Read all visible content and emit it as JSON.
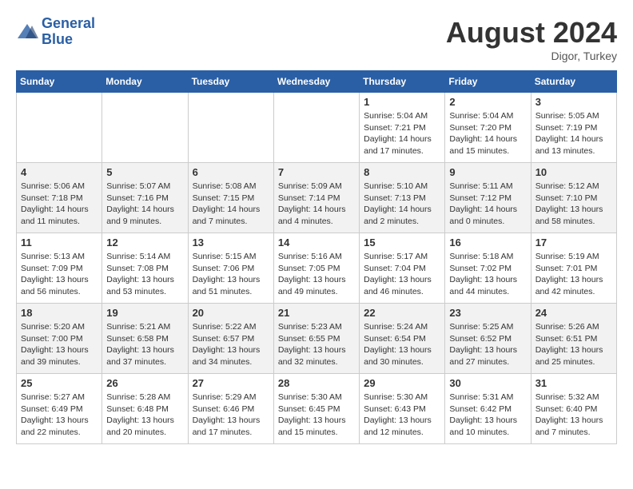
{
  "header": {
    "logo_line1": "General",
    "logo_line2": "Blue",
    "month_year": "August 2024",
    "location": "Digor, Turkey"
  },
  "days_of_week": [
    "Sunday",
    "Monday",
    "Tuesday",
    "Wednesday",
    "Thursday",
    "Friday",
    "Saturday"
  ],
  "weeks": [
    [
      {
        "day": "",
        "empty": true
      },
      {
        "day": "",
        "empty": true
      },
      {
        "day": "",
        "empty": true
      },
      {
        "day": "",
        "empty": true
      },
      {
        "day": "1",
        "sunrise": "5:04 AM",
        "sunset": "7:21 PM",
        "daylight": "14 hours and 17 minutes."
      },
      {
        "day": "2",
        "sunrise": "5:04 AM",
        "sunset": "7:20 PM",
        "daylight": "14 hours and 15 minutes."
      },
      {
        "day": "3",
        "sunrise": "5:05 AM",
        "sunset": "7:19 PM",
        "daylight": "14 hours and 13 minutes."
      }
    ],
    [
      {
        "day": "4",
        "sunrise": "5:06 AM",
        "sunset": "7:18 PM",
        "daylight": "14 hours and 11 minutes."
      },
      {
        "day": "5",
        "sunrise": "5:07 AM",
        "sunset": "7:16 PM",
        "daylight": "14 hours and 9 minutes."
      },
      {
        "day": "6",
        "sunrise": "5:08 AM",
        "sunset": "7:15 PM",
        "daylight": "14 hours and 7 minutes."
      },
      {
        "day": "7",
        "sunrise": "5:09 AM",
        "sunset": "7:14 PM",
        "daylight": "14 hours and 4 minutes."
      },
      {
        "day": "8",
        "sunrise": "5:10 AM",
        "sunset": "7:13 PM",
        "daylight": "14 hours and 2 minutes."
      },
      {
        "day": "9",
        "sunrise": "5:11 AM",
        "sunset": "7:12 PM",
        "daylight": "14 hours and 0 minutes."
      },
      {
        "day": "10",
        "sunrise": "5:12 AM",
        "sunset": "7:10 PM",
        "daylight": "13 hours and 58 minutes."
      }
    ],
    [
      {
        "day": "11",
        "sunrise": "5:13 AM",
        "sunset": "7:09 PM",
        "daylight": "13 hours and 56 minutes."
      },
      {
        "day": "12",
        "sunrise": "5:14 AM",
        "sunset": "7:08 PM",
        "daylight": "13 hours and 53 minutes."
      },
      {
        "day": "13",
        "sunrise": "5:15 AM",
        "sunset": "7:06 PM",
        "daylight": "13 hours and 51 minutes."
      },
      {
        "day": "14",
        "sunrise": "5:16 AM",
        "sunset": "7:05 PM",
        "daylight": "13 hours and 49 minutes."
      },
      {
        "day": "15",
        "sunrise": "5:17 AM",
        "sunset": "7:04 PM",
        "daylight": "13 hours and 46 minutes."
      },
      {
        "day": "16",
        "sunrise": "5:18 AM",
        "sunset": "7:02 PM",
        "daylight": "13 hours and 44 minutes."
      },
      {
        "day": "17",
        "sunrise": "5:19 AM",
        "sunset": "7:01 PM",
        "daylight": "13 hours and 42 minutes."
      }
    ],
    [
      {
        "day": "18",
        "sunrise": "5:20 AM",
        "sunset": "7:00 PM",
        "daylight": "13 hours and 39 minutes."
      },
      {
        "day": "19",
        "sunrise": "5:21 AM",
        "sunset": "6:58 PM",
        "daylight": "13 hours and 37 minutes."
      },
      {
        "day": "20",
        "sunrise": "5:22 AM",
        "sunset": "6:57 PM",
        "daylight": "13 hours and 34 minutes."
      },
      {
        "day": "21",
        "sunrise": "5:23 AM",
        "sunset": "6:55 PM",
        "daylight": "13 hours and 32 minutes."
      },
      {
        "day": "22",
        "sunrise": "5:24 AM",
        "sunset": "6:54 PM",
        "daylight": "13 hours and 30 minutes."
      },
      {
        "day": "23",
        "sunrise": "5:25 AM",
        "sunset": "6:52 PM",
        "daylight": "13 hours and 27 minutes."
      },
      {
        "day": "24",
        "sunrise": "5:26 AM",
        "sunset": "6:51 PM",
        "daylight": "13 hours and 25 minutes."
      }
    ],
    [
      {
        "day": "25",
        "sunrise": "5:27 AM",
        "sunset": "6:49 PM",
        "daylight": "13 hours and 22 minutes."
      },
      {
        "day": "26",
        "sunrise": "5:28 AM",
        "sunset": "6:48 PM",
        "daylight": "13 hours and 20 minutes."
      },
      {
        "day": "27",
        "sunrise": "5:29 AM",
        "sunset": "6:46 PM",
        "daylight": "13 hours and 17 minutes."
      },
      {
        "day": "28",
        "sunrise": "5:30 AM",
        "sunset": "6:45 PM",
        "daylight": "13 hours and 15 minutes."
      },
      {
        "day": "29",
        "sunrise": "5:30 AM",
        "sunset": "6:43 PM",
        "daylight": "13 hours and 12 minutes."
      },
      {
        "day": "30",
        "sunrise": "5:31 AM",
        "sunset": "6:42 PM",
        "daylight": "13 hours and 10 minutes."
      },
      {
        "day": "31",
        "sunrise": "5:32 AM",
        "sunset": "6:40 PM",
        "daylight": "13 hours and 7 minutes."
      }
    ]
  ]
}
